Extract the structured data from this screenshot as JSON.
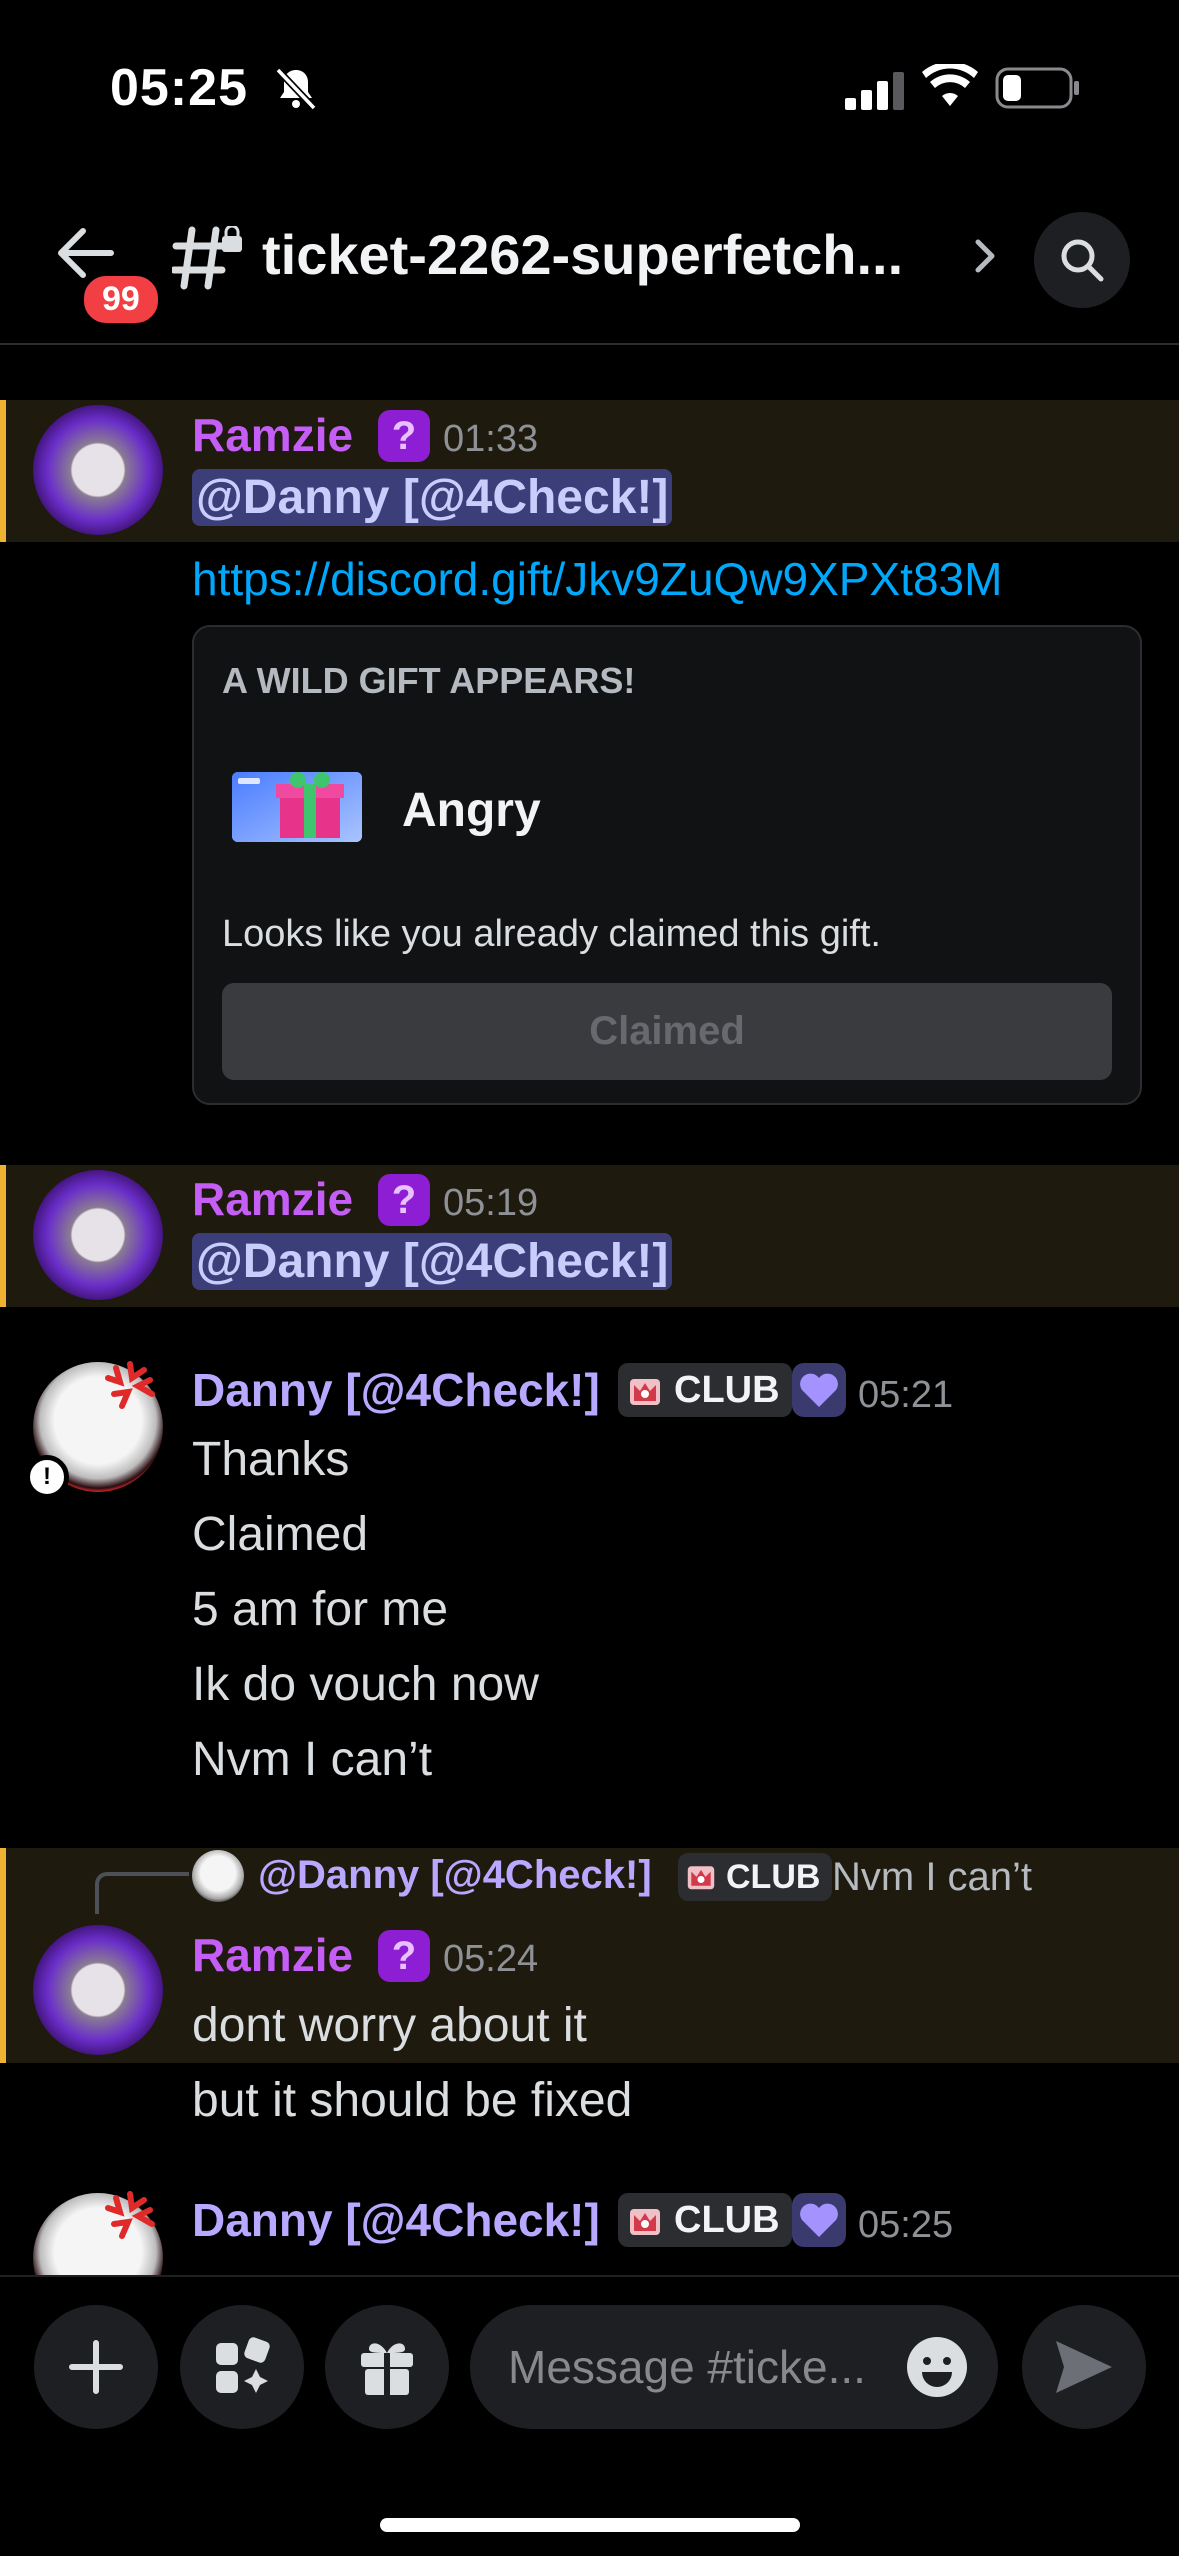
{
  "status": {
    "time": "05:25"
  },
  "header": {
    "back_badge": "99",
    "channel_name": "ticket-2262-superfetch..."
  },
  "messages": [
    {
      "author": "Ramzie",
      "time": "01:33",
      "mention": "@Danny [@4Check!]",
      "link": "https://discord.gift/Jkv9ZuQw9XPXt83M",
      "gift": {
        "heading": "A WILD GIFT APPEARS!",
        "name": "Angry",
        "description": "Looks like you already claimed this gift.",
        "button": "Claimed"
      }
    },
    {
      "author": "Ramzie",
      "time": "05:19",
      "mention": "@Danny [@4Check!]"
    },
    {
      "author": "Danny [@4Check!]",
      "tag": "CLUB",
      "time": "05:21",
      "lines": [
        "Thanks",
        "Claimed",
        "5 am for me",
        "Ik do vouch now",
        "Nvm I can’t"
      ]
    },
    {
      "reply": {
        "author": "@Danny [@4Check!]",
        "tag": "CLUB",
        "text": "Nvm I can’t"
      },
      "author": "Ramzie",
      "time": "05:24",
      "lines": [
        "dont worry about it",
        "but it should be fixed"
      ]
    },
    {
      "author": "Danny [@4Check!]",
      "tag": "CLUB",
      "time": "05:25"
    }
  ],
  "composer": {
    "placeholder": "Message #ticke..."
  },
  "icons": [
    "bell-slash-icon",
    "signal-icon",
    "wifi-icon",
    "battery-icon",
    "back-arrow-icon",
    "private-channel-icon",
    "chevron-right-icon",
    "search-icon",
    "question-role-icon",
    "club-role-icon",
    "heart-icon",
    "plus-icon",
    "apps-icon",
    "gift-icon",
    "emoji-icon",
    "send-icon"
  ],
  "colors": {
    "ramzie": "#c45ef6",
    "danny": "#b8a8ff",
    "link": "#00a8fc",
    "highlight_bar": "#f0b232"
  }
}
